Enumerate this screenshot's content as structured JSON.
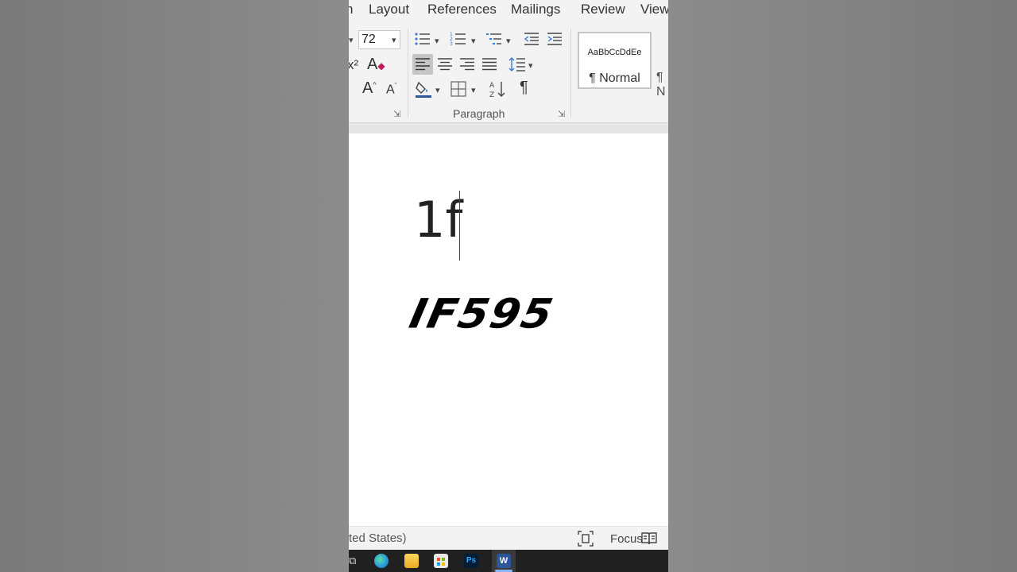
{
  "ribbon": {
    "tabs": [
      {
        "label": "n"
      },
      {
        "label": "Layout"
      },
      {
        "label": "References"
      },
      {
        "label": "Mailings"
      },
      {
        "label": "Review"
      },
      {
        "label": "View"
      }
    ],
    "font_size_value": "72",
    "font_size_options_visible": [
      "72"
    ],
    "paragraph_group_label": "Paragraph",
    "styles": {
      "normal_sample": "AaBbCcDdEe",
      "normal_name": "¶ Normal",
      "next_name_partial": "¶ N"
    },
    "icons": {
      "bullets": "bullets-icon",
      "numbering": "numbering-icon",
      "multilevel": "multilevel-list-icon",
      "decrease_indent": "decrease-indent-icon",
      "increase_indent": "increase-indent-icon",
      "align_left": "align-left-icon",
      "align_center": "align-center-icon",
      "align_right": "align-right-icon",
      "justify": "justify-icon",
      "line_spacing": "line-spacing-icon",
      "shading": "shading-icon",
      "borders": "borders-icon",
      "sort": "sort-icon",
      "show_marks": "pilcrow-icon",
      "superscript": "superscript-icon",
      "clear_formatting": "clear-formatting-icon",
      "grow_font": "grow-font-icon",
      "shrink_font": "shrink-font-icon"
    },
    "glyphs": {
      "show_marks": "¶",
      "superscript": "x²",
      "clear_formatting": "A",
      "grow_font": "A",
      "shrink_font": "A"
    }
  },
  "document": {
    "typed_text": "1f",
    "logo_text": "IF595"
  },
  "status_bar": {
    "language": "ted States)",
    "focus_label": "Focus"
  },
  "taskbar": {
    "icons": [
      "taskview-icon",
      "edge-icon",
      "file-explorer-icon",
      "store-icon",
      "photoshop-icon",
      "word-icon"
    ],
    "ps_label": "Ps",
    "word_label": "W"
  },
  "colors": {
    "background": "#858585",
    "ribbon": "#f3f3f3",
    "taskbar": "#202020",
    "accent_blue": "#2b579a"
  }
}
